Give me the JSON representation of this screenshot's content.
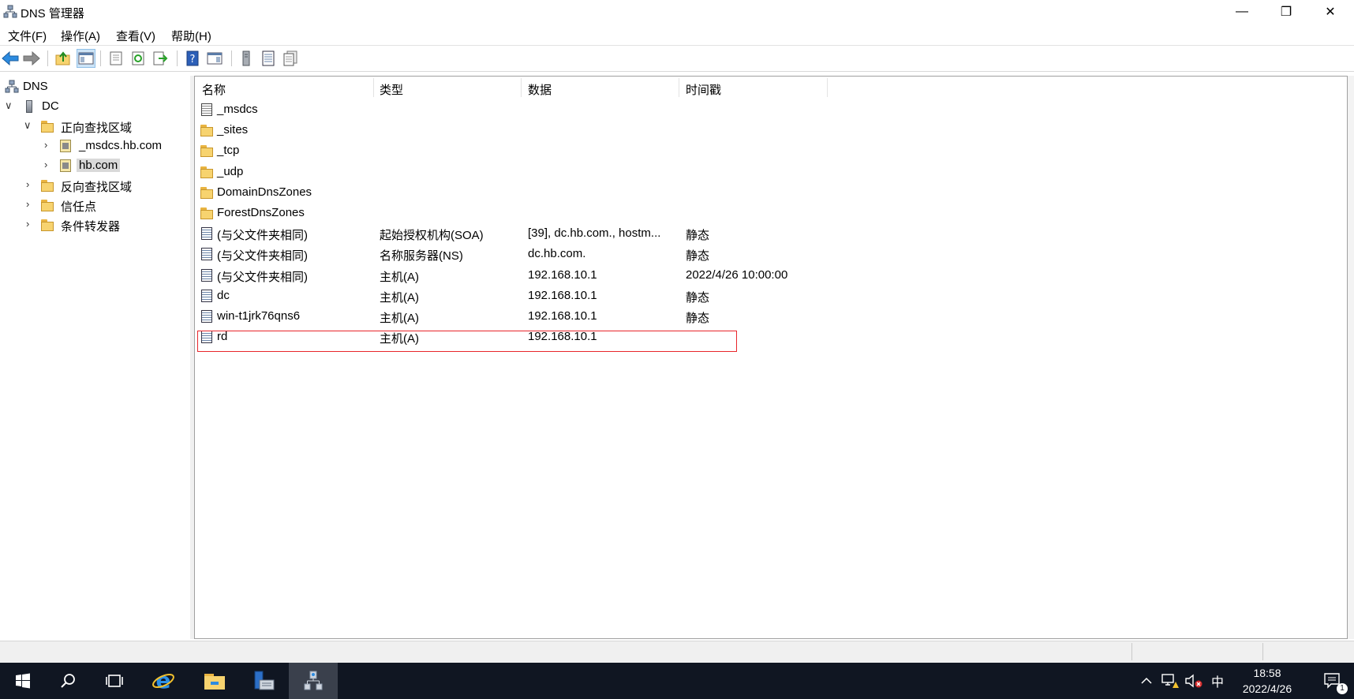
{
  "window": {
    "title": "DNS 管理器",
    "minimize_glyph": "—",
    "restore_glyph": "❐",
    "close_glyph": "✕"
  },
  "menu": [
    "文件(F)",
    "操作(A)",
    "查看(V)",
    "帮助(H)"
  ],
  "toolbar": {
    "buttons": [
      "back-arrow-icon",
      "forward-arrow-icon",
      "up-folder-icon",
      "show-hide-console-tree-icon",
      "properties-icon",
      "refresh-icon",
      "export-list-icon",
      "help-icon",
      "show-hide-action-pane-icon",
      "server-icon",
      "list-view-icon",
      "multi-record-icon"
    ]
  },
  "tree": {
    "items": [
      {
        "label": "DNS",
        "level": 0,
        "expander": "",
        "icon": "dns-root-icon"
      },
      {
        "label": "DC",
        "level": 1,
        "expander": "∨",
        "icon": "server-icon"
      },
      {
        "label": "正向查找区域",
        "level": 2,
        "expander": "∨",
        "icon": "folder-icon"
      },
      {
        "label": "_msdcs.hb.com",
        "level": 3,
        "expander": "›",
        "icon": "zone-icon"
      },
      {
        "label": "hb.com",
        "level": 3,
        "expander": "›",
        "icon": "zone-icon",
        "selected": true
      },
      {
        "label": "反向查找区域",
        "level": 2,
        "expander": "›",
        "icon": "folder-icon"
      },
      {
        "label": "信任点",
        "level": 2,
        "expander": "›",
        "icon": "folder-icon"
      },
      {
        "label": "条件转发器",
        "level": 2,
        "expander": "›",
        "icon": "folder-icon"
      }
    ]
  },
  "list": {
    "columns": [
      "名称",
      "类型",
      "数据",
      "时间戳"
    ],
    "rows": [
      {
        "name": "_msdcs",
        "type": "",
        "data": "",
        "timestamp": "",
        "icon": "msdcs-icon"
      },
      {
        "name": "_sites",
        "type": "",
        "data": "",
        "timestamp": "",
        "icon": "folder-icon"
      },
      {
        "name": "_tcp",
        "type": "",
        "data": "",
        "timestamp": "",
        "icon": "folder-icon"
      },
      {
        "name": "_udp",
        "type": "",
        "data": "",
        "timestamp": "",
        "icon": "folder-icon"
      },
      {
        "name": "DomainDnsZones",
        "type": "",
        "data": "",
        "timestamp": "",
        "icon": "folder-icon"
      },
      {
        "name": "ForestDnsZones",
        "type": "",
        "data": "",
        "timestamp": "",
        "icon": "folder-icon"
      },
      {
        "name": "(与父文件夹相同)",
        "type": "起始授权机构(SOA)",
        "data": "[39], dc.hb.com., hostm...",
        "timestamp": "静态",
        "icon": "record-icon"
      },
      {
        "name": "(与父文件夹相同)",
        "type": "名称服务器(NS)",
        "data": "dc.hb.com.",
        "timestamp": "静态",
        "icon": "record-icon"
      },
      {
        "name": "(与父文件夹相同)",
        "type": "主机(A)",
        "data": "192.168.10.1",
        "timestamp": "2022/4/26 10:00:00",
        "icon": "record-icon"
      },
      {
        "name": "dc",
        "type": "主机(A)",
        "data": "192.168.10.1",
        "timestamp": "静态",
        "icon": "record-icon"
      },
      {
        "name": "win-t1jrk76qns6",
        "type": "主机(A)",
        "data": "192.168.10.1",
        "timestamp": "静态",
        "icon": "record-icon"
      },
      {
        "name": "rd",
        "type": "主机(A)",
        "data": "192.168.10.1",
        "timestamp": "",
        "icon": "record-icon",
        "highlighted": true
      }
    ]
  },
  "taskbar": {
    "buttons": [
      "start-icon",
      "search-icon",
      "task-view-icon",
      "internet-explorer-icon",
      "file-explorer-icon",
      "server-manager-icon",
      "dns-manager-icon"
    ],
    "tray": {
      "ime": "中",
      "time": "18:58",
      "date": "2022/4/26",
      "notification_count": "1"
    }
  },
  "colors": {
    "highlight_border": "#e8262b",
    "taskbar_bg": "#101622",
    "selected_tree_bg": "#d9d9d9"
  }
}
